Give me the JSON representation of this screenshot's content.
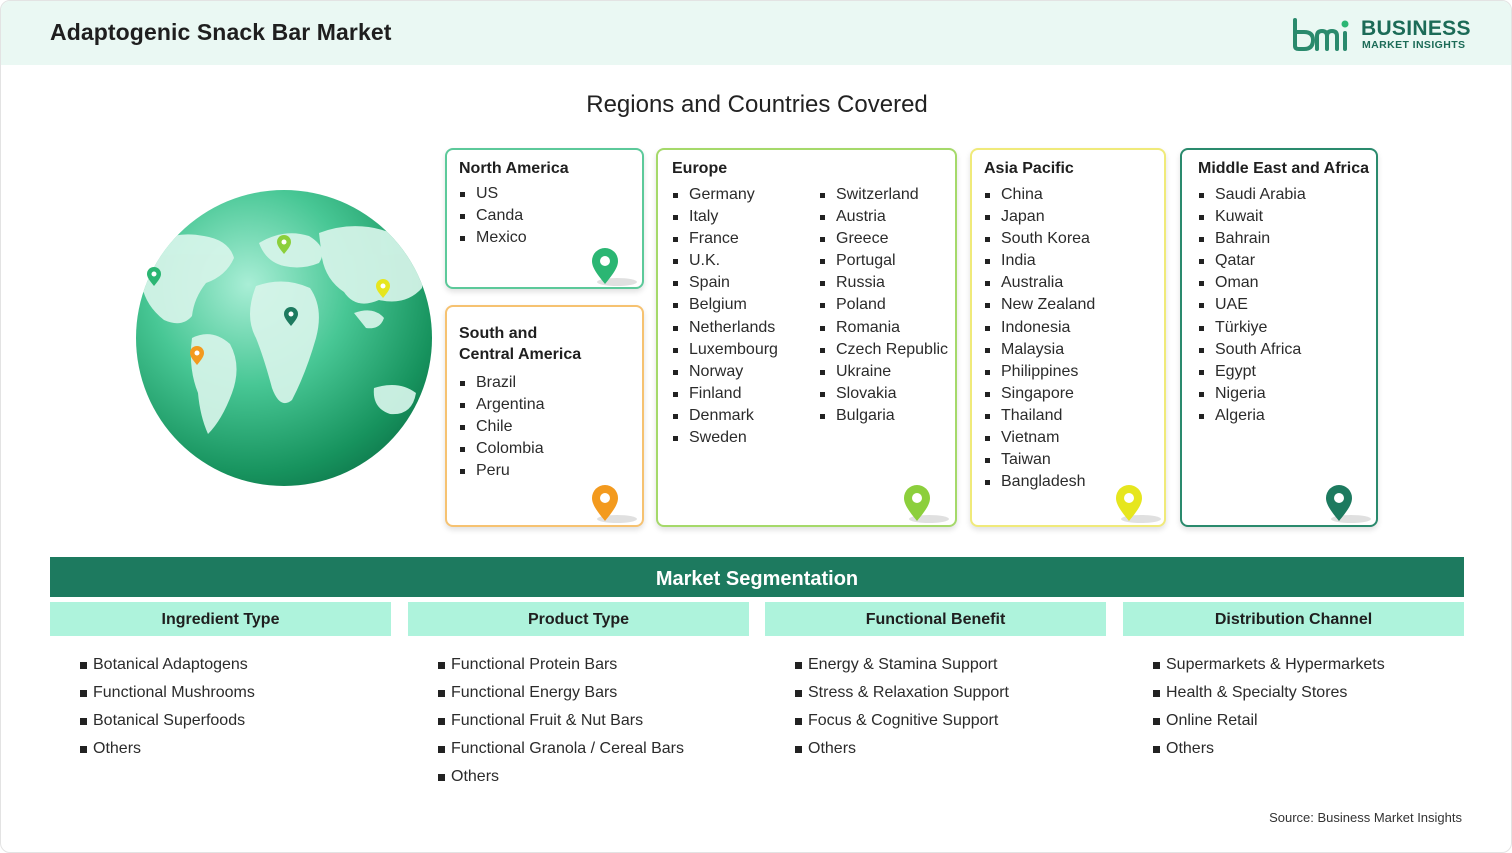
{
  "header": {
    "title": "Adaptogenic Snack Bar Market",
    "logo_line1": "BUSINESS",
    "logo_line2": "MARKET INSIGHTS",
    "logo_mark": "bmi"
  },
  "regions_title": "Regions and Countries Covered",
  "regions": [
    {
      "name": "North America",
      "color": "#2bb673",
      "pin_color": "#2bb673",
      "col1": [
        "US",
        "Canda",
        "Mexico"
      ]
    },
    {
      "name": "Europe",
      "color": "#9bd34a",
      "pin_color": "#8ccf3c",
      "col1": [
        "Germany",
        "Italy",
        "France",
        "U.K.",
        "Spain",
        "Belgium",
        "Netherlands",
        "Luxembourg",
        "Norway",
        "Finland",
        "Denmark",
        "Sweden"
      ],
      "col2": [
        "Switzerland",
        "Austria",
        "Greece",
        "Portugal",
        "Russia",
        "Poland",
        "Romania",
        "Czech Republic",
        "Ukraine",
        "Slovakia",
        "Bulgaria"
      ]
    },
    {
      "name": "Asia Pacific",
      "color": "#f2e85a",
      "pin_color": "#e6e61e",
      "col1": [
        "China",
        "Japan",
        "South Korea",
        "India",
        "Australia",
        "New Zealand",
        "Indonesia",
        "Malaysia",
        "Philippines",
        "Singapore",
        "Thailand",
        "Vietnam",
        "Taiwan",
        "Bangladesh"
      ]
    },
    {
      "name": "Middle East and Africa",
      "color": "#1d7a5f",
      "pin_color": "#1d7a5f",
      "col1": [
        "Saudi Arabia",
        "Kuwait",
        "Bahrain",
        "Qatar",
        "Oman",
        "UAE",
        "Türkiye",
        "South Africa",
        "Egypt",
        "Nigeria",
        "Algeria"
      ]
    },
    {
      "name_line1": "South and",
      "name_line2": "Central America",
      "color": "#f6b857",
      "pin_color": "#f39a1e",
      "col1": [
        "Brazil",
        "Argentina",
        "Chile",
        "Colombia",
        "Peru"
      ]
    }
  ],
  "segmentation": {
    "title": "Market Segmentation",
    "columns": [
      {
        "heading": "Ingredient Type",
        "items": [
          "Botanical Adaptogens",
          "Functional Mushrooms",
          "Botanical Superfoods",
          "Others"
        ]
      },
      {
        "heading": "Product Type",
        "items": [
          "Functional Protein Bars",
          "Functional Energy Bars",
          "Functional Fruit & Nut Bars",
          "Functional Granola / Cereal Bars",
          "Others"
        ]
      },
      {
        "heading": "Functional Benefit",
        "items": [
          "Energy & Stamina Support",
          "Stress & Relaxation Support",
          "Focus & Cognitive Support",
          "Others"
        ]
      },
      {
        "heading": "Distribution Channel",
        "items": [
          "Supermarkets & Hypermarkets",
          "Health & Specialty Stores",
          "Online Retail",
          "Others"
        ]
      }
    ]
  },
  "source": "Source: Business Market Insights",
  "icons": [
    "globe-icon",
    "map-pin-icon",
    "bmi-logo-icon"
  ],
  "colors": {
    "accent_dark": "#1d7a5f",
    "accent_light": "#aef3dc",
    "header_bg": "#eaf8f3"
  }
}
